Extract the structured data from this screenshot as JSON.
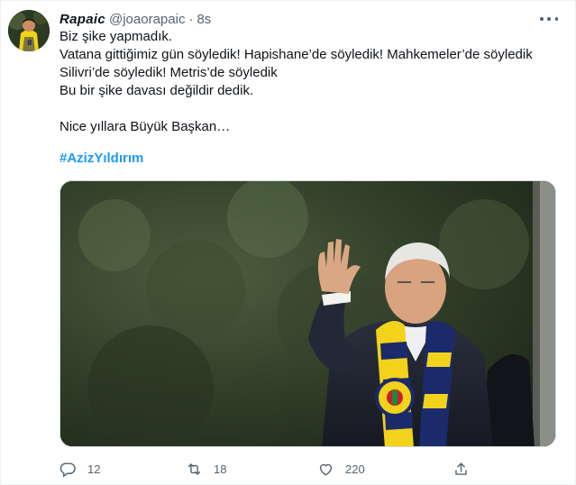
{
  "tweet": {
    "display_name": "Rapaic",
    "handle": "@joaorapaic",
    "separator": "·",
    "time": "8s",
    "lines": [
      "Biz şike yapmadık.",
      "Vatana gittiğimiz gün söyledik! Hapishane’de söyledik! Mahkemeler’de söyledik",
      "Silivri’de söyledik! Metris’de söyledik",
      "Bu bir şike davası değildir dedik.",
      "",
      "Nice yıllara Büyük Başkan…"
    ],
    "hashtag": "#AzizYıldırım"
  },
  "actions": {
    "replies": "12",
    "retweets": "18",
    "likes": "220"
  },
  "colors": {
    "accent": "#1d9bf0",
    "text": "#0f1419",
    "secondary": "#536471",
    "border": "#eff3f4"
  },
  "icons": {
    "more": "ellipsis-icon",
    "reply": "reply-icon",
    "retweet": "retweet-icon",
    "like": "heart-icon",
    "share": "share-icon"
  }
}
